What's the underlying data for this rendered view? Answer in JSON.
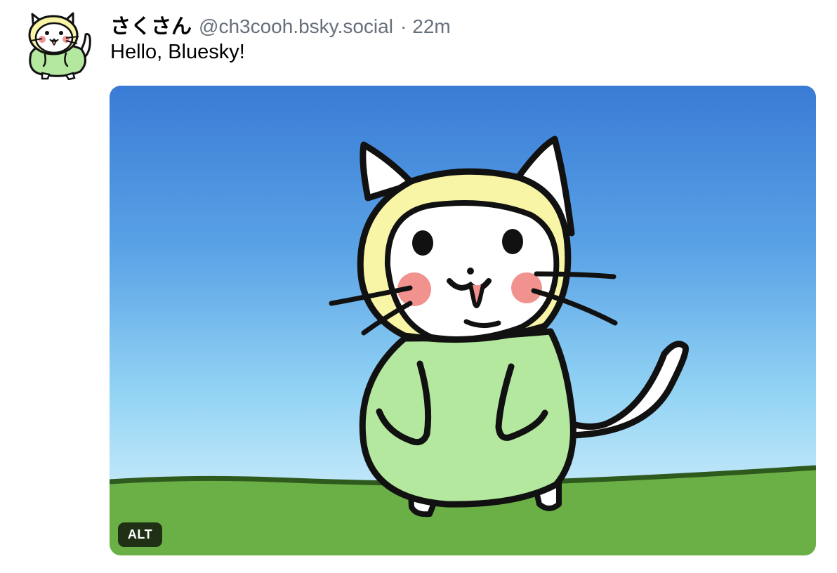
{
  "post": {
    "author": {
      "display_name": "さくさん",
      "handle": "@ch3cooh.bsky.social"
    },
    "separator": "·",
    "time": "22m",
    "text": "Hello, Bluesky!",
    "image": {
      "alt_label": "ALT",
      "avatar_icon": "cat-in-green-hoodie-avatar-icon",
      "main_icon": "cat-in-green-hoodie-illustration"
    }
  },
  "colors": {
    "handle_gray": "#66707b",
    "sky_top": "#3a7bd5",
    "sky_bottom": "#e3f6fd",
    "grass": "#6ab046",
    "hoodie": "#b4e89e",
    "hood_inner": "#f8f5a6",
    "blush": "#f1928f",
    "alt_badge_bg": "#141e0f"
  }
}
